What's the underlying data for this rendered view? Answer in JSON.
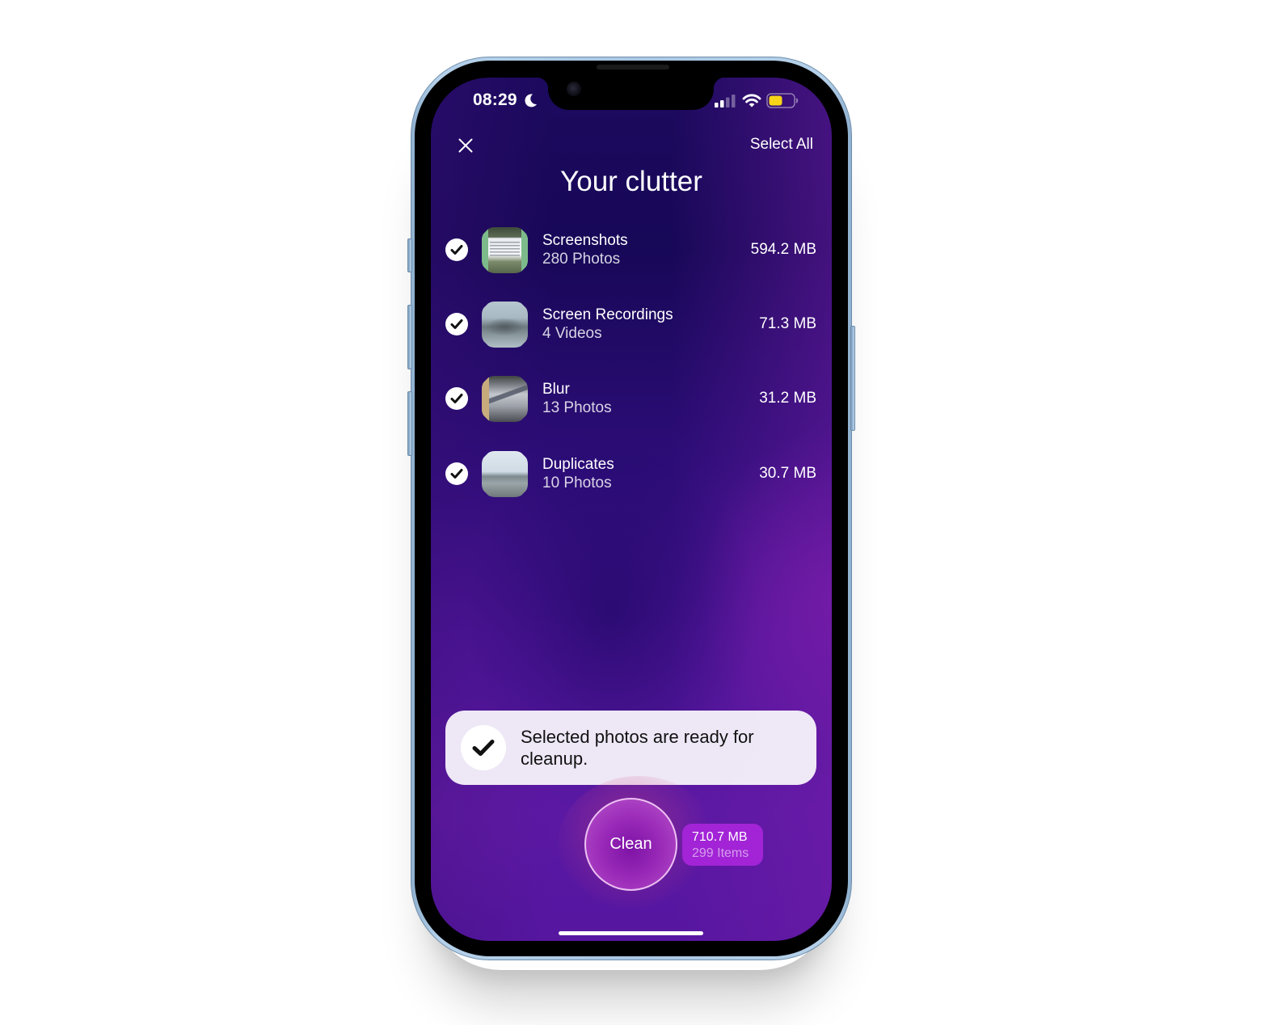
{
  "status_bar": {
    "time": "08:29",
    "focus_icon": "moon-icon",
    "signal_icon": "cellular-signal-icon",
    "wifi_icon": "wifi-icon",
    "battery_icon": "battery-icon",
    "battery_color": "#f7d417"
  },
  "header": {
    "close_icon": "close-icon",
    "select_all_label": "Select All",
    "title": "Your clutter"
  },
  "categories": [
    {
      "title": "Screenshots",
      "subtitle": "280 Photos",
      "size": "594.2 MB",
      "selected": true,
      "thumbnail": "screenshots-thumbnail"
    },
    {
      "title": "Screen Recordings",
      "subtitle": "4 Videos",
      "size": "71.3 MB",
      "selected": true,
      "thumbnail": "screen-recordings-thumbnail"
    },
    {
      "title": "Blur",
      "subtitle": "13 Photos",
      "size": "31.2 MB",
      "selected": true,
      "thumbnail": "blur-thumbnail"
    },
    {
      "title": "Duplicates",
      "subtitle": "10 Photos",
      "size": "30.7 MB",
      "selected": true,
      "thumbnail": "duplicates-thumbnail"
    }
  ],
  "toast": {
    "icon": "checkmark-icon",
    "message": "Selected photos are ready for cleanup."
  },
  "action": {
    "clean_label": "Clean",
    "total_size": "710.7 MB",
    "total_items": "299 Items"
  },
  "colors": {
    "background_dark": "#1a0a5c",
    "background_purple": "#7a1aa6",
    "badge": "#a224d6",
    "toast_bg": "#f5f0fa",
    "frame": "#a9c7e3"
  }
}
